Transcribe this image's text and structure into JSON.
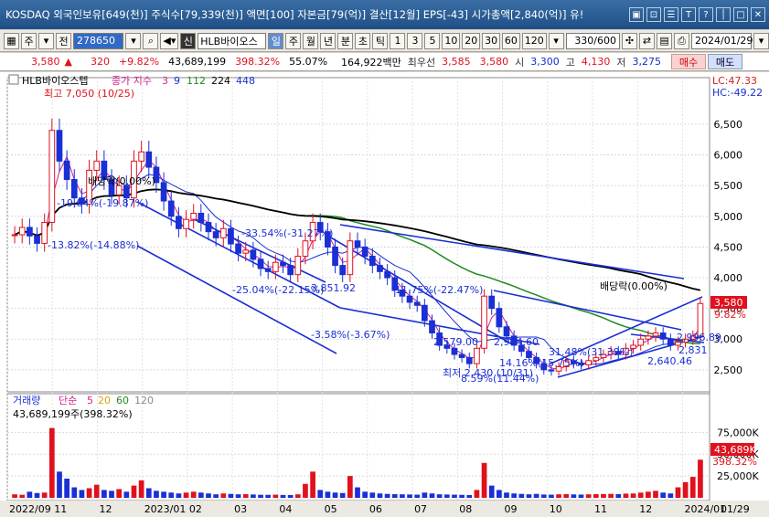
{
  "titlebar": {
    "text": "KOSDAQ 외국인보유[649(천)] 주식수[79,339(천)] 액면[100] 자본금[79(억)] 결산[12월] EPS[-43] 시가총액[2,840(억)] 유!",
    "buttons": [
      "▣",
      "⊡",
      "☰",
      "T",
      "?",
      "│",
      "□",
      "✕"
    ]
  },
  "toolbar": {
    "market": "주",
    "prev_label": "전",
    "code": "278650",
    "stock_name": "HLB바이오스",
    "period_options": [
      "일",
      "주",
      "월",
      "년",
      "분",
      "초",
      "틱"
    ],
    "active_period": "일",
    "intervals": [
      "1",
      "3",
      "5",
      "10",
      "20",
      "30",
      "60",
      "120"
    ],
    "count": "330/600",
    "date": "2024/01/29",
    "sin_label": "신"
  },
  "quote": {
    "price": "3,580",
    "change_arrow": "▲",
    "change": "320",
    "change_pct": "+9.82%",
    "volume": "43,689,199",
    "volume_ratio": "398.32%",
    "turnover_ratio": "55.07%",
    "trade_amount": "164,922백만",
    "best_bid_label": "최우선",
    "best_ask": "3,585",
    "best_bid": "3,580",
    "open_label": "시",
    "open": "3,300",
    "high_label": "고",
    "high": "4,130",
    "low_label": "저",
    "low": "3,275",
    "buy_label": "매수",
    "sell_label": "매도"
  },
  "legend": {
    "stock_label": "HLB바이오스텝",
    "close_label": "종가 지수",
    "ma": [
      "3",
      "9",
      "112",
      "224",
      "448"
    ],
    "ma_colors": [
      "#d11f8c",
      "#1a2fd4",
      "#1f8a1f",
      "#000000",
      "#1a2fd4"
    ],
    "volume_label": "거래량",
    "volume_ma_label": "단순",
    "volume_ma": [
      "5",
      "20",
      "60",
      "120"
    ],
    "volume_ma_colors": [
      "#d11f8c",
      "#d6a40a",
      "#1f8a1f",
      "#888888"
    ],
    "volume_text": "43,689,199주(398.32%)",
    "lc": "LC:47.33",
    "hc": "HC:-49.22",
    "price_tag": "3,580",
    "pct_tag": "9.82%",
    "vol_tag": "43,689K",
    "vol_pct_tag": "398.32%"
  },
  "annotations": {
    "high": "최고 7,050 (10/25)",
    "low": "최저 2,430 (10/31)",
    "dividend_1": "배당락(0.00%)",
    "dividend_2": "배당락(0.00%)",
    "labels": [
      "-19.84%(-19.87%)",
      "-13.82%(-14.88%)",
      "-33.54%(-31.27%)",
      "-25.04%(-22.15%)",
      "3,851.92",
      "-11.75%(-22.47%)",
      "-3.58%(-3.67%)",
      "2,579.00",
      "2,904.60",
      "31.48%(31.39%)",
      "14.16%(15.75%)",
      "8.59%(11.44%)",
      "2,640.46",
      "2,831",
      "2,996.89"
    ]
  },
  "chart_data": {
    "type": "candlestick",
    "x_ticks": [
      "2022/09",
      "11",
      "12",
      "2023/01",
      "02",
      "03",
      "04",
      "05",
      "06",
      "07",
      "08",
      "09",
      "10",
      "11",
      "12",
      "2024/01",
      "01/29"
    ],
    "y_ticks": [
      2500,
      3000,
      3500,
      4000,
      4500,
      5000,
      5500,
      6000,
      6500
    ],
    "ylim": [
      2200,
      7200
    ],
    "volume_ticks": [
      "25,000K",
      "50,000K",
      "75,000K"
    ],
    "volume_ylim": [
      0,
      90000
    ],
    "close": [
      4700,
      4820,
      4680,
      4560,
      4900,
      6400,
      5900,
      5600,
      5300,
      5200,
      5750,
      5900,
      5600,
      5350,
      5500,
      5300,
      5900,
      6050,
      5800,
      5550,
      5250,
      5000,
      4800,
      4950,
      5050,
      4900,
      4750,
      4650,
      4800,
      4550,
      4400,
      4450,
      4300,
      4150,
      4100,
      4250,
      4200,
      4050,
      4350,
      4600,
      4900,
      4750,
      4500,
      4200,
      4050,
      4600,
      4500,
      4350,
      4200,
      4100,
      4000,
      3800,
      3700,
      3600,
      3550,
      3300,
      3100,
      2900,
      2850,
      2750,
      2700,
      2600,
      2850,
      3700,
      3500,
      3200,
      3050,
      2900,
      2800,
      2700,
      2600,
      2500,
      2480,
      2550,
      2650,
      2600,
      2580,
      2650,
      2700,
      2750,
      2800,
      2750,
      2850,
      2900,
      3000,
      3050,
      3100,
      3000,
      2900,
      2950,
      3000,
      3050,
      3580
    ],
    "volume": [
      4000,
      3500,
      7000,
      5500,
      6000,
      80000,
      30000,
      22000,
      12000,
      9000,
      11000,
      15000,
      9000,
      8000,
      10000,
      7000,
      14000,
      20000,
      11000,
      8000,
      7000,
      6000,
      5000,
      6000,
      7000,
      6000,
      5000,
      4000,
      5000,
      4500,
      4000,
      4200,
      3800,
      3500,
      3400,
      3600,
      3300,
      3200,
      4000,
      16000,
      30000,
      9000,
      7000,
      6000,
      5500,
      25000,
      12000,
      7000,
      6000,
      5000,
      4500,
      4200,
      4000,
      3800,
      3600,
      6000,
      5000,
      4000,
      3800,
      3600,
      3400,
      3200,
      9000,
      40000,
      14000,
      9000,
      6000,
      5000,
      4500,
      4000,
      4500,
      3800,
      3600,
      4000,
      4200,
      3900,
      3700,
      4000,
      4200,
      4300,
      4500,
      4200,
      4800,
      5000,
      6000,
      7000,
      8000,
      6000,
      5000,
      12000,
      18000,
      24000,
      43689
    ]
  }
}
